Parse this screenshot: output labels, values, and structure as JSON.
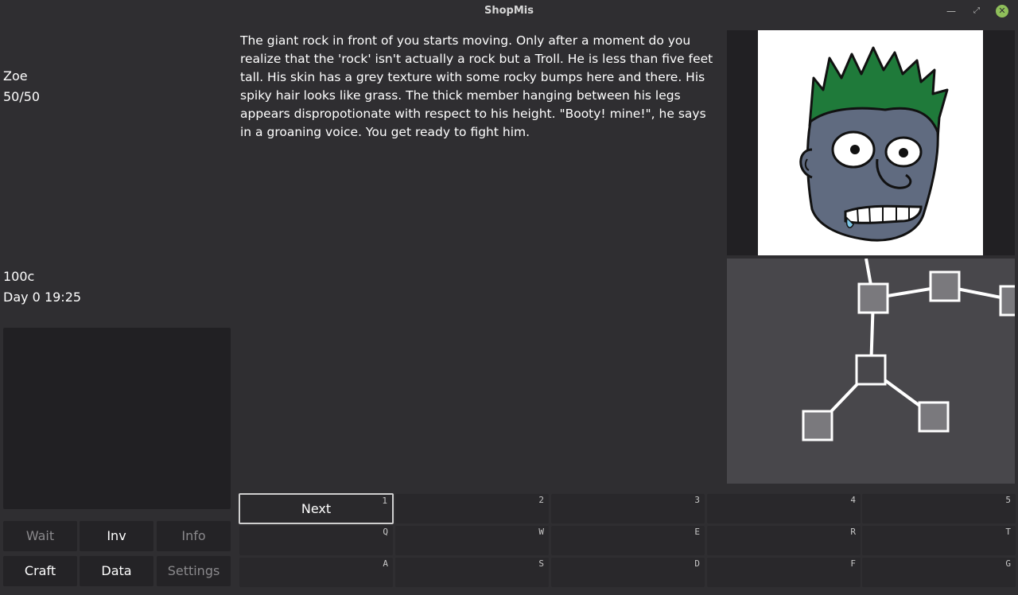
{
  "window": {
    "title": "ShopMis"
  },
  "player": {
    "name": "Zoe",
    "hp": "50/50",
    "money": "100c",
    "time": "Day 0 19:25"
  },
  "side_buttons": {
    "wait": "Wait",
    "inv": "Inv",
    "info": "Info",
    "craft": "Craft",
    "data": "Data",
    "settings": "Settings"
  },
  "story": {
    "text": "The giant rock in front of you starts moving. Only after a moment do you realize that the 'rock' isn't actually a rock but a Troll. He is less than five feet tall. His skin has a grey texture with some rocky bumps here and there. His spiky hair looks like grass. The thick member hanging between his legs appears dispropotionate with respect to his height. \"Booty! mine!\", he says in a groaning voice. You get ready to fight him."
  },
  "actions": {
    "row1": [
      {
        "hotkey": "1",
        "label": "Next"
      },
      {
        "hotkey": "2",
        "label": ""
      },
      {
        "hotkey": "3",
        "label": ""
      },
      {
        "hotkey": "4",
        "label": ""
      },
      {
        "hotkey": "5",
        "label": ""
      }
    ],
    "row2": [
      {
        "hotkey": "Q",
        "label": ""
      },
      {
        "hotkey": "W",
        "label": ""
      },
      {
        "hotkey": "E",
        "label": ""
      },
      {
        "hotkey": "R",
        "label": ""
      },
      {
        "hotkey": "T",
        "label": ""
      }
    ],
    "row3": [
      {
        "hotkey": "A",
        "label": ""
      },
      {
        "hotkey": "S",
        "label": ""
      },
      {
        "hotkey": "D",
        "label": ""
      },
      {
        "hotkey": "F",
        "label": ""
      },
      {
        "hotkey": "G",
        "label": ""
      }
    ]
  },
  "icons": {
    "minimize": "minimize-icon",
    "maximize": "maximize-icon",
    "close": "close-icon",
    "portrait": "troll-portrait-icon",
    "map": "map-graph-icon"
  },
  "colors": {
    "background": "#2f2e31",
    "panel": "#212023",
    "map_bg": "#48474b",
    "troll_hair": "#1f7a3a",
    "troll_skin": "#606b80",
    "close_button": "#8fbf5a"
  }
}
